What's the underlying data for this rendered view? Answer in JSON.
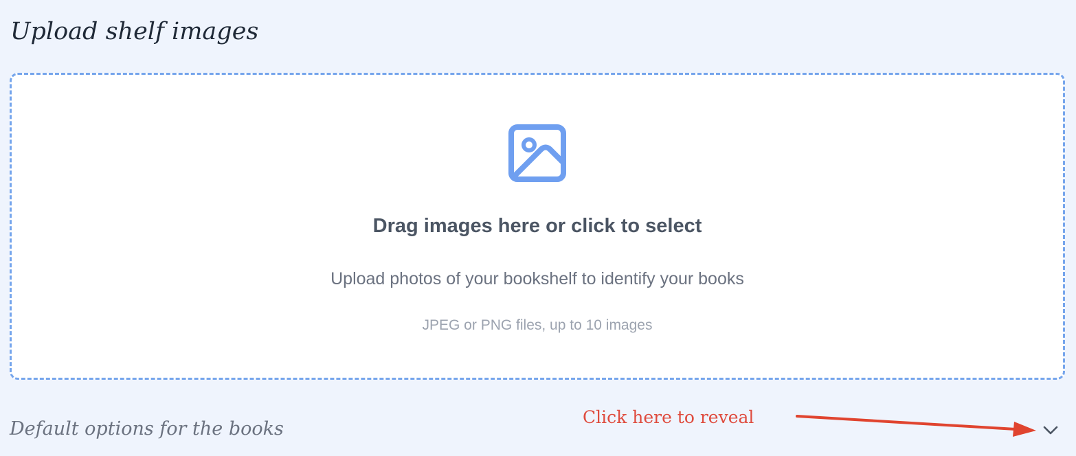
{
  "page": {
    "title": "Upload shelf images"
  },
  "dropzone": {
    "icon": "image-icon",
    "heading": "Drag images here or click to select",
    "subtext": "Upload photos of your bookshelf to identify your books",
    "note": "JPEG or PNG files, up to 10 images"
  },
  "options": {
    "label": "Default options for the books",
    "toggle_icon": "chevron-down-icon"
  },
  "annotation": {
    "text": "Click here to reveal"
  },
  "colors": {
    "background": "#eff4fd",
    "dropzone_border": "#75a5ec",
    "icon_blue": "#6f9ff0",
    "annotation_red": "#df4b3e"
  }
}
